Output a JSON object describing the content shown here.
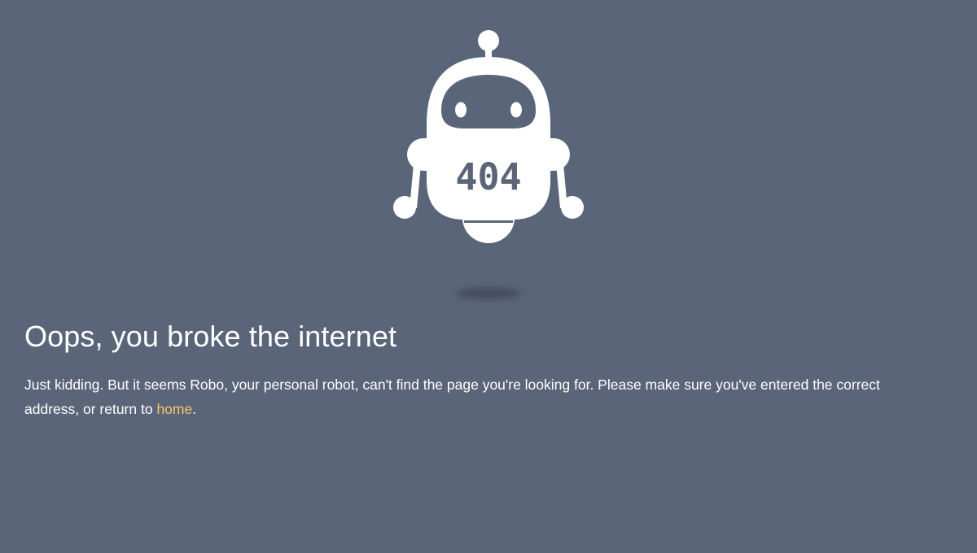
{
  "robot": {
    "display_code": "404"
  },
  "headline": "Oops, you broke the internet",
  "message": {
    "text_before": "Just kidding. But it seems Robo, your personal robot, can't find the page you're looking for. Please make sure you've entered the correct address, or return to ",
    "link_text": "home",
    "text_after": "."
  },
  "colors": {
    "background": "#5b6579",
    "robot": "#ffffff",
    "link": "#f5c66b"
  }
}
